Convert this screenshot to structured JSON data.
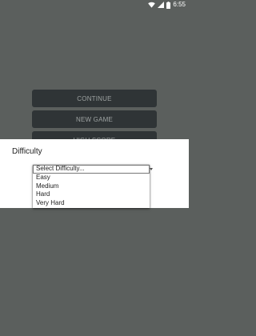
{
  "status_bar": {
    "time": "6:55"
  },
  "menu": {
    "continue_label": "CONTINUE",
    "new_game_label": "NEW GAME",
    "high_score_label": "HIGH SCORE"
  },
  "dialog": {
    "title": "Difficulty",
    "options": [
      "Select Difficulty...",
      "Easy",
      "Medium",
      "Hard",
      "Very Hard"
    ],
    "selected_option": "Select Difficulty..."
  },
  "colors": {
    "background": "#5b5f5d",
    "button_bg": "#2f3436",
    "button_text": "#9ea3a2",
    "dialog_bg": "#ffffff"
  }
}
